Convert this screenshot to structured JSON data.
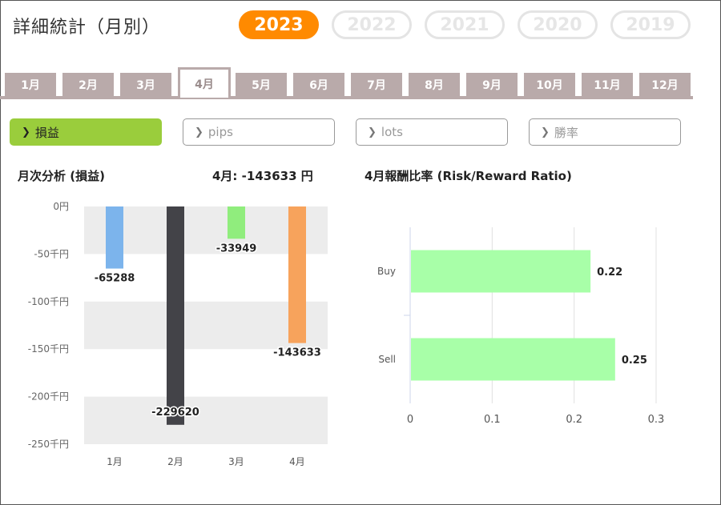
{
  "page": {
    "title": "詳細統計（月別）"
  },
  "years": [
    "2023",
    "2022",
    "2021",
    "2020",
    "2019"
  ],
  "selected_year": "2023",
  "months": [
    "1月",
    "2月",
    "3月",
    "4月",
    "5月",
    "6月",
    "7月",
    "8月",
    "9月",
    "10月",
    "11月",
    "12月"
  ],
  "selected_month": "4月",
  "metrics": [
    "損益",
    "pips",
    "lots",
    "勝率"
  ],
  "selected_metric": "損益",
  "summary": {
    "title": "月次分析 (損益)",
    "current": "4月:  -143633 円"
  },
  "colors": {
    "accent": "#ff8a00",
    "metric_active": "#9acd3c",
    "tab": "#b9aaaa"
  },
  "chart_data": [
    {
      "type": "bar",
      "title": "月次分析 (損益)",
      "categories": [
        "1月",
        "2月",
        "3月",
        "4月"
      ],
      "values": [
        -65288,
        -229620,
        -33949,
        -143633
      ],
      "data_labels": [
        "-65288",
        "-229620",
        "-33949",
        "-143633"
      ],
      "colors": [
        "#7cb4ec",
        "#434348",
        "#90ed7d",
        "#f7a35c"
      ],
      "ylim": [
        -250000,
        0
      ],
      "yticks": [
        0,
        -50000,
        -100000,
        -150000,
        -200000,
        -250000
      ],
      "ytick_labels": [
        "0円",
        "-50千円",
        "-100千円",
        "-150千円",
        "-200千円",
        "-250千円"
      ],
      "grid": "alternating bands"
    },
    {
      "type": "bar",
      "orientation": "horizontal",
      "title": "4月報酬比率 (Risk/Reward Ratio)",
      "categories": [
        "Buy",
        "Sell"
      ],
      "values": [
        0.22,
        0.25
      ],
      "data_labels": [
        "0.22",
        "0.25"
      ],
      "color": "#a8ffa8",
      "xlim": [
        0,
        0.3
      ],
      "xticks": [
        0,
        0.1,
        0.2,
        0.3
      ],
      "xtick_labels": [
        "0",
        "0.1",
        "0.2",
        "0.3"
      ],
      "grid": true
    }
  ]
}
